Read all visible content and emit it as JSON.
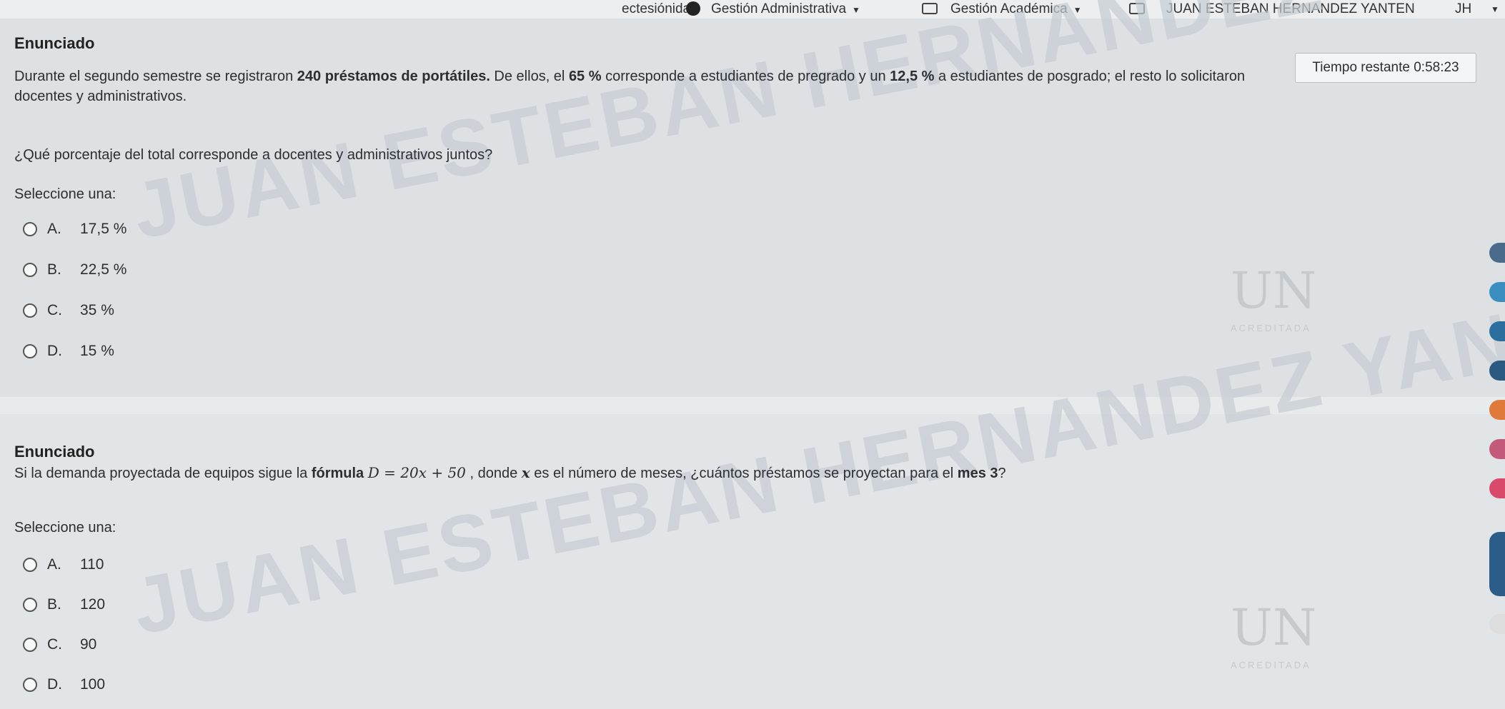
{
  "topbar": {
    "nav_partial": "ectesiónidad",
    "admin": "Gestión Administrativa",
    "academic": "Gestión Académica",
    "user_name": "JUAN ESTEBAN HERNANDEZ YANTEN",
    "user_initials": "JH"
  },
  "timer": {
    "label": "Tiempo restante 0:58:23"
  },
  "watermark": "JUAN ESTEBAN HERNANDEZ YANTEN",
  "logo": {
    "letters": "UN",
    "accredited": "ACREDITADA"
  },
  "question1": {
    "heading": "Enunciado",
    "text_part1": "Durante el segundo semestre se registraron ",
    "text_bold1": "240 préstamos de portátiles.",
    "text_part2": " De ellos, el ",
    "text_bold2": "65 %",
    "text_part3": " corresponde a estudiantes de pregrado y un ",
    "text_bold3": "12,5 %",
    "text_part4": " a estudiantes de posgrado; el resto lo solicitaron",
    "text_line2": "docentes y administrativos.",
    "question": "¿Qué porcentaje del total corresponde a docentes y administrativos juntos?",
    "select_label": "Seleccione una:",
    "options": [
      {
        "letter": "A.",
        "value": "17,5 %"
      },
      {
        "letter": "B.",
        "value": "22,5 %"
      },
      {
        "letter": "C.",
        "value": "35 %"
      },
      {
        "letter": "D.",
        "value": "15 %"
      }
    ]
  },
  "question2": {
    "heading": "Enunciado",
    "text_part1": "Si la demanda proyectada de equipos sigue la ",
    "text_bold1": "fórmula",
    "formula": "D  =  20x  +  50",
    "text_part2": " , donde ",
    "text_var": "x",
    "text_part3": " es el número de meses, ¿cuántos préstamos se proyectan para el ",
    "text_bold2": "mes 3",
    "text_part4": "?",
    "select_label": "Seleccione una:",
    "options": [
      {
        "letter": "A.",
        "value": "110"
      },
      {
        "letter": "B.",
        "value": "120"
      },
      {
        "letter": "C.",
        "value": "90"
      },
      {
        "letter": "D.",
        "value": "100"
      }
    ]
  },
  "colors": {
    "page_bg": "#dfe3e5",
    "text": "#2b2f33",
    "watermark": "#c5ccd2"
  }
}
